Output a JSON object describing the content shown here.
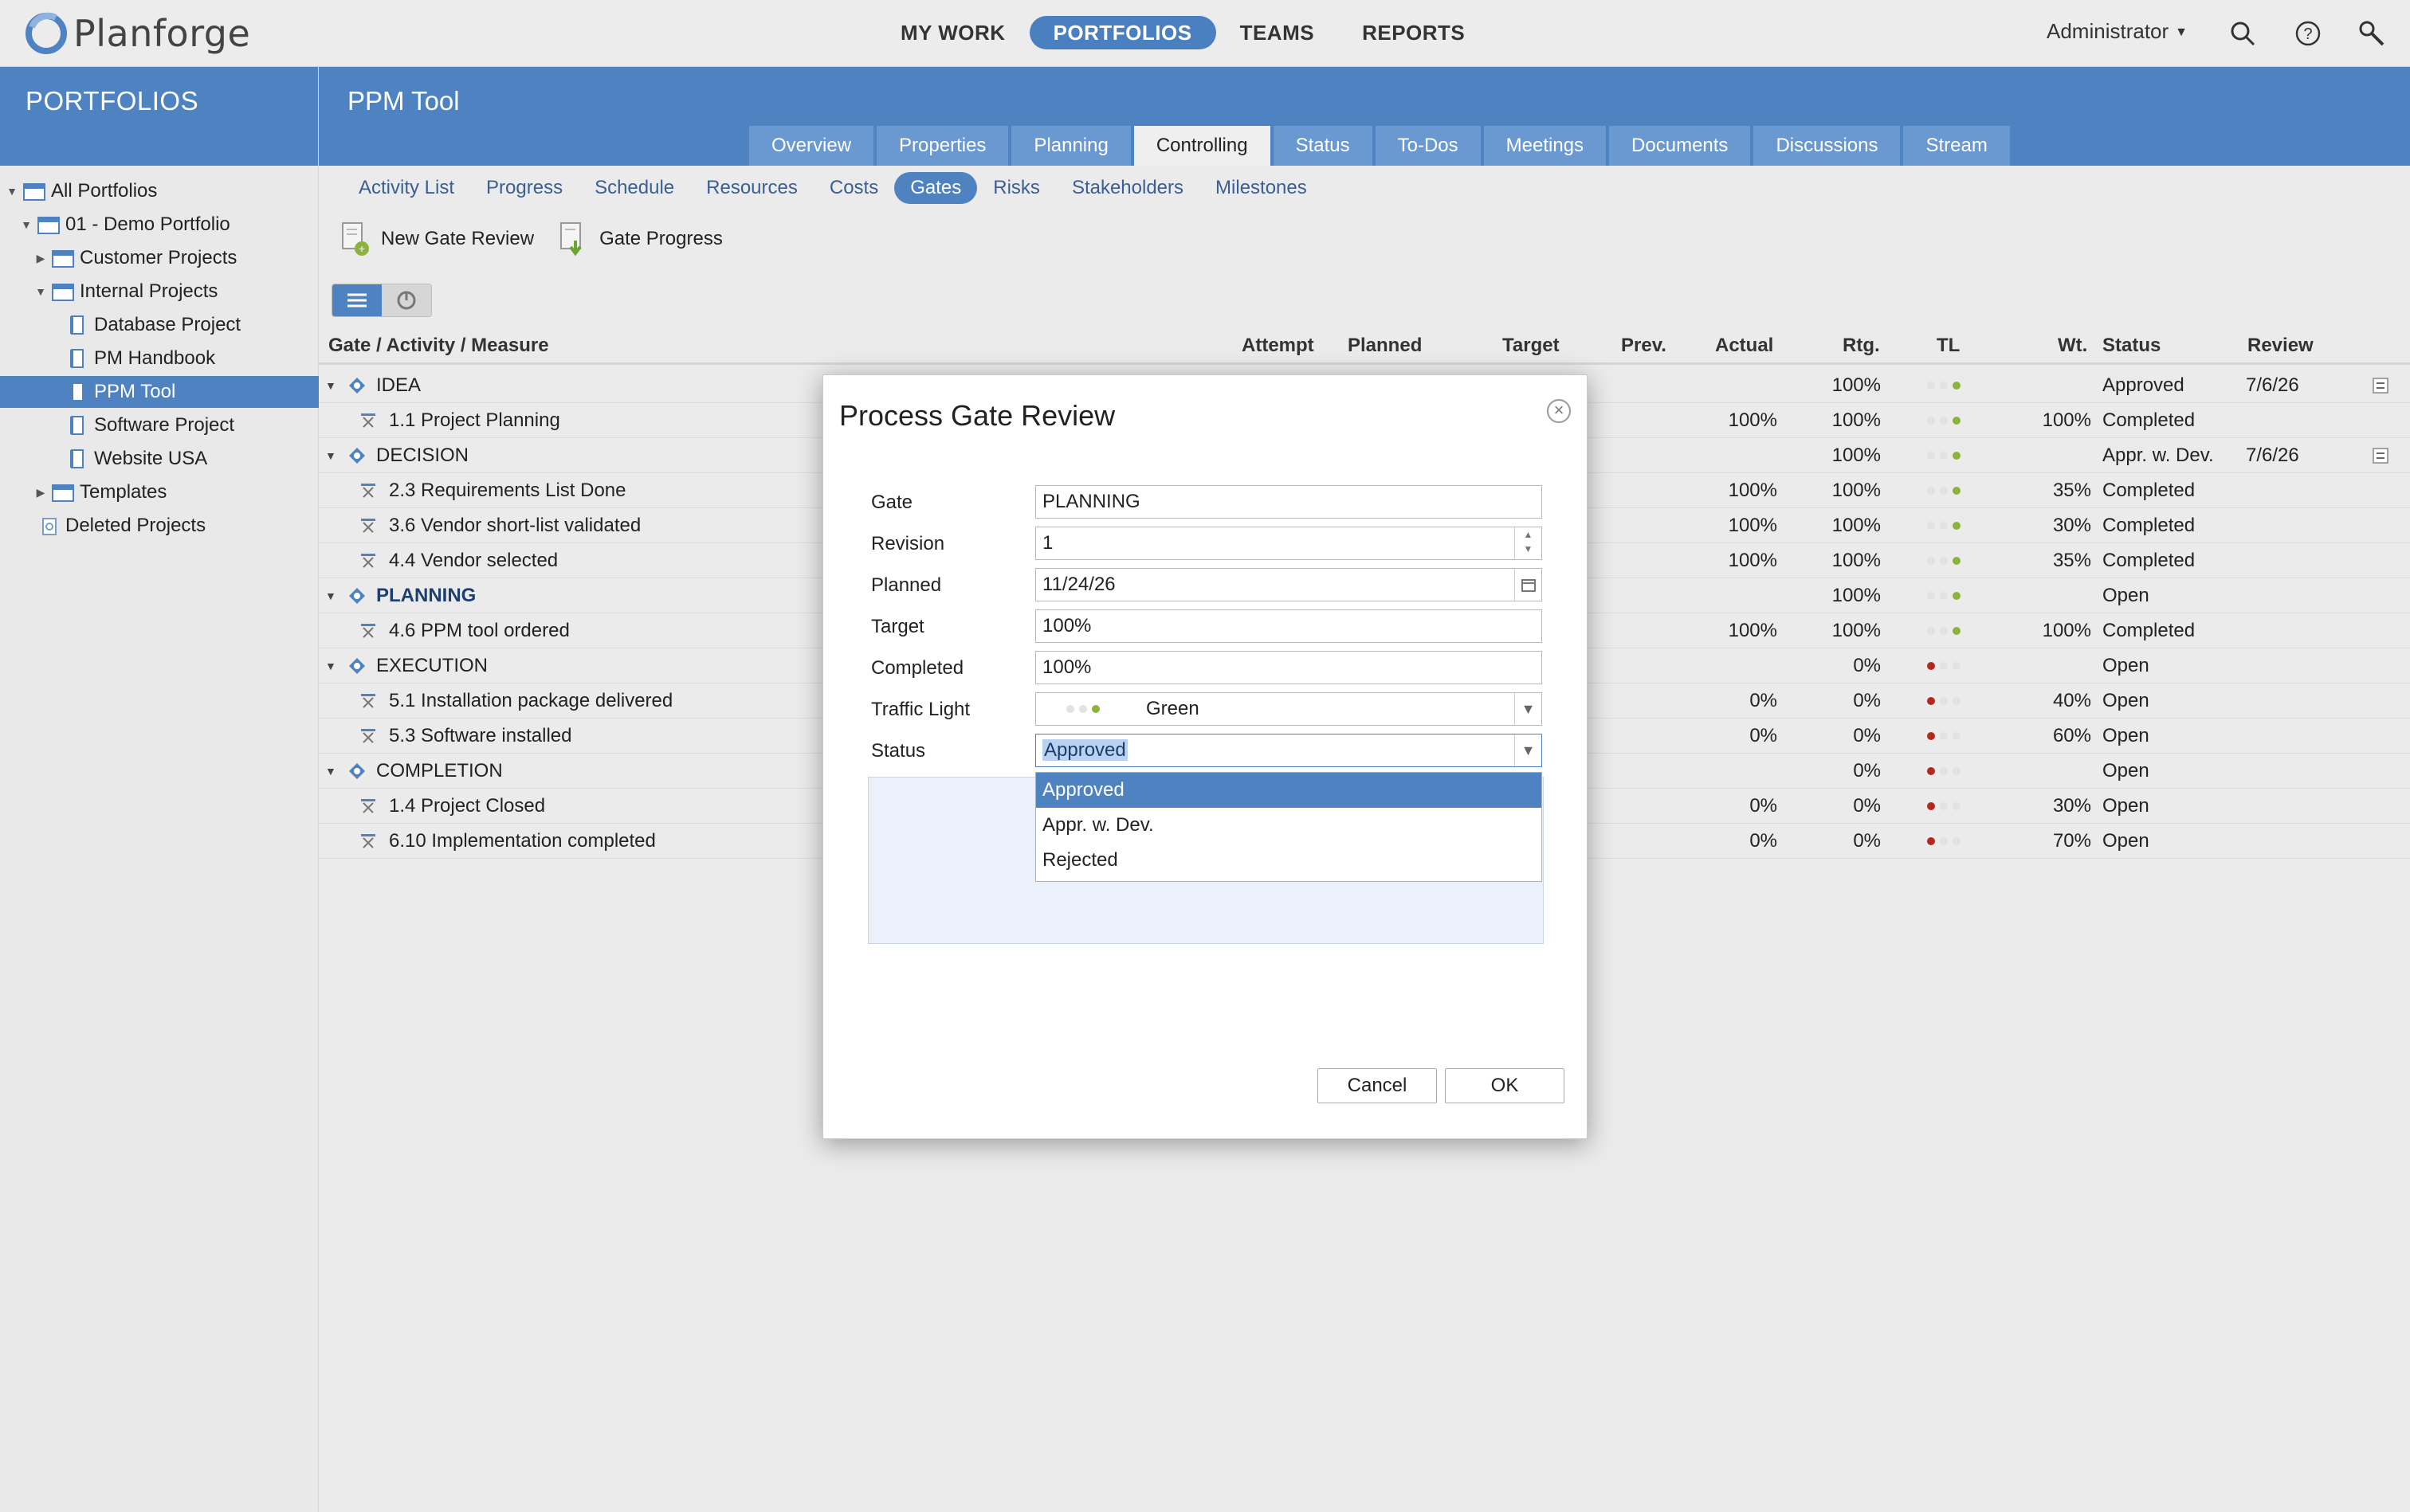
{
  "app": {
    "name": "Planforge"
  },
  "topnav": {
    "items": [
      {
        "label": "MY WORK",
        "active": false
      },
      {
        "label": "PORTFOLIOS",
        "active": true
      },
      {
        "label": "TEAMS",
        "active": false
      },
      {
        "label": "REPORTS",
        "active": false
      }
    ],
    "user": "Administrator",
    "icons": [
      "search-icon",
      "help-icon",
      "tools-icon"
    ]
  },
  "sidebar": {
    "title": "PORTFOLIOS",
    "tree": [
      {
        "label": "All Portfolios",
        "level": 0,
        "expanded": true
      },
      {
        "label": "01 - Demo Portfolio",
        "level": 1,
        "expanded": true
      },
      {
        "label": "Customer Projects",
        "level": 2,
        "expanded": false
      },
      {
        "label": "Internal Projects",
        "level": 2,
        "expanded": true
      },
      {
        "label": "Database Project",
        "level": 3
      },
      {
        "label": "PM Handbook",
        "level": 3
      },
      {
        "label": "PPM Tool",
        "level": 3,
        "selected": true
      },
      {
        "label": "Software Project",
        "level": 3
      },
      {
        "label": "Website USA",
        "level": 3
      },
      {
        "label": "Templates",
        "level": 2,
        "expanded": false
      },
      {
        "label": "Deleted Projects",
        "level": 1
      }
    ]
  },
  "project": {
    "title": "PPM Tool",
    "tabs": [
      "Overview",
      "Properties",
      "Planning",
      "Controlling",
      "Status",
      "To-Dos",
      "Meetings",
      "Documents",
      "Discussions",
      "Stream"
    ],
    "active_tab": "Controlling",
    "subtabs": [
      "Activity List",
      "Progress",
      "Schedule",
      "Resources",
      "Costs",
      "Gates",
      "Risks",
      "Stakeholders",
      "Milestones"
    ],
    "active_subtab": "Gates"
  },
  "toolbar": {
    "new_gate_review": "New Gate Review",
    "gate_progress": "Gate Progress"
  },
  "table": {
    "columns": [
      "Gate / Activity / Measure",
      "Attempt",
      "Planned",
      "Target",
      "Prev.",
      "Actual",
      "Rtg.",
      "TL",
      "Wt.",
      "Status",
      "Review"
    ],
    "rows": [
      {
        "type": "gate",
        "name": "IDEA",
        "actual": "",
        "rtg": "100%",
        "tl": "green",
        "wt": "",
        "status": "Approved",
        "review": "7/6/26",
        "bold": false
      },
      {
        "type": "activity",
        "name": "1.1 Project Planning",
        "actual": "100%",
        "rtg": "100%",
        "tl": "green",
        "wt": "100%",
        "status": "Completed",
        "review": ""
      },
      {
        "type": "gate",
        "name": "DECISION",
        "actual": "",
        "rtg": "100%",
        "tl": "green",
        "wt": "",
        "status": "Appr. w. Dev.",
        "review": "7/6/26",
        "bold": false
      },
      {
        "type": "activity",
        "name": "2.3 Requirements List Done",
        "actual": "100%",
        "rtg": "100%",
        "tl": "green",
        "wt": "35%",
        "status": "Completed",
        "review": ""
      },
      {
        "type": "activity",
        "name": "3.6 Vendor short-list validated",
        "actual": "100%",
        "rtg": "100%",
        "tl": "green",
        "wt": "30%",
        "status": "Completed",
        "review": ""
      },
      {
        "type": "activity",
        "name": "4.4 Vendor selected",
        "actual": "100%",
        "rtg": "100%",
        "tl": "green",
        "wt": "35%",
        "status": "Completed",
        "review": ""
      },
      {
        "type": "gate",
        "name": "PLANNING",
        "actual": "",
        "rtg": "100%",
        "tl": "green",
        "wt": "",
        "status": "Open",
        "review": "",
        "bold": true
      },
      {
        "type": "activity",
        "name": "4.6 PPM tool ordered",
        "actual": "100%",
        "rtg": "100%",
        "tl": "green",
        "wt": "100%",
        "status": "Completed",
        "review": ""
      },
      {
        "type": "gate",
        "name": "EXECUTION",
        "actual": "",
        "rtg": "0%",
        "tl": "red",
        "wt": "",
        "status": "Open",
        "review": "",
        "bold": false
      },
      {
        "type": "activity",
        "name": "5.1 Installation package delivered",
        "actual": "0%",
        "rtg": "0%",
        "tl": "red",
        "wt": "40%",
        "status": "Open",
        "review": ""
      },
      {
        "type": "activity",
        "name": "5.3 Software installed",
        "actual": "0%",
        "rtg": "0%",
        "tl": "red",
        "wt": "60%",
        "status": "Open",
        "review": ""
      },
      {
        "type": "gate",
        "name": "COMPLETION",
        "actual": "",
        "rtg": "0%",
        "tl": "red",
        "wt": "",
        "status": "Open",
        "review": "",
        "bold": false
      },
      {
        "type": "activity",
        "name": "1.4 Project Closed",
        "actual": "0%",
        "rtg": "0%",
        "tl": "red",
        "wt": "30%",
        "status": "Open",
        "review": ""
      },
      {
        "type": "activity",
        "name": "6.10 Implementation completed",
        "actual": "0%",
        "rtg": "0%",
        "tl": "red",
        "wt": "70%",
        "status": "Open",
        "review": ""
      }
    ]
  },
  "dialog": {
    "title": "Process Gate Review",
    "fields": {
      "gate": {
        "label": "Gate",
        "value": "PLANNING"
      },
      "revision": {
        "label": "Revision",
        "value": "1"
      },
      "planned": {
        "label": "Planned",
        "value": "11/24/26"
      },
      "target": {
        "label": "Target",
        "value": "100%"
      },
      "completed": {
        "label": "Completed",
        "value": "100%"
      },
      "traffic_light": {
        "label": "Traffic Light",
        "value": "Green"
      },
      "status": {
        "label": "Status",
        "value": "Approved"
      }
    },
    "status_options": [
      "Approved",
      "Appr. w. Dev.",
      "Rejected"
    ],
    "cancel": "Cancel",
    "ok": "OK"
  },
  "colors": {
    "accent": "#4f82c1",
    "green": "#8cb43c",
    "red": "#b4281e"
  }
}
